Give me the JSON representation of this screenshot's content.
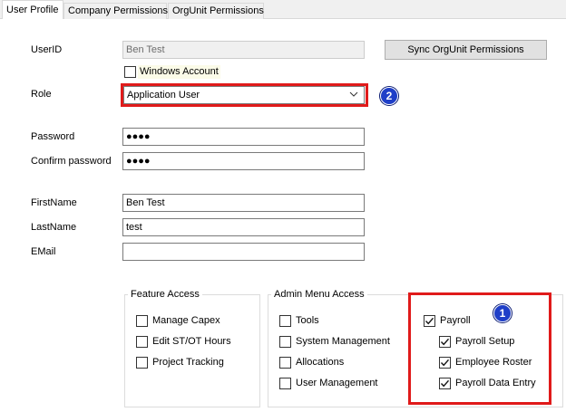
{
  "tabs": [
    {
      "label": "User Profile"
    },
    {
      "label": "Company Permissions"
    },
    {
      "label": "OrgUnit Permissions"
    }
  ],
  "form": {
    "userid_label": "UserID",
    "userid_value": "Ben Test",
    "windows_account_label": "Windows Account",
    "windows_account_checked": false,
    "sync_button": "Sync OrgUnit Permissions",
    "role_label": "Role",
    "role_value": "Application User",
    "password_label": "Password",
    "password_value": "●●●●",
    "confirm_label": "Confirm password",
    "confirm_value": "●●●●",
    "firstname_label": "FirstName",
    "firstname_value": "Ben Test",
    "lastname_label": "LastName",
    "lastname_value": "test",
    "email_label": "EMail",
    "email_value": ""
  },
  "feature_access": {
    "title": "Feature Access",
    "items": [
      {
        "label": "Manage Capex",
        "checked": false
      },
      {
        "label": "Edit ST/OT Hours",
        "checked": false
      },
      {
        "label": "Project Tracking",
        "checked": false
      }
    ]
  },
  "admin_menu": {
    "title": "Admin Menu Access",
    "items": [
      {
        "label": "Tools",
        "checked": false
      },
      {
        "label": "System Management",
        "checked": false
      },
      {
        "label": "Allocations",
        "checked": false
      },
      {
        "label": "User Management",
        "checked": false
      }
    ],
    "payroll": {
      "label": "Payroll",
      "checked": true
    },
    "payroll_items": [
      {
        "label": "Payroll Setup",
        "checked": true
      },
      {
        "label": "Employee Roster",
        "checked": true
      },
      {
        "label": "Payroll Data Entry",
        "checked": true
      }
    ]
  },
  "annotations": {
    "badge_1": "1",
    "badge_2": "2",
    "highlight_color": "#e01a1a",
    "badge_color": "#1f3fc8"
  }
}
